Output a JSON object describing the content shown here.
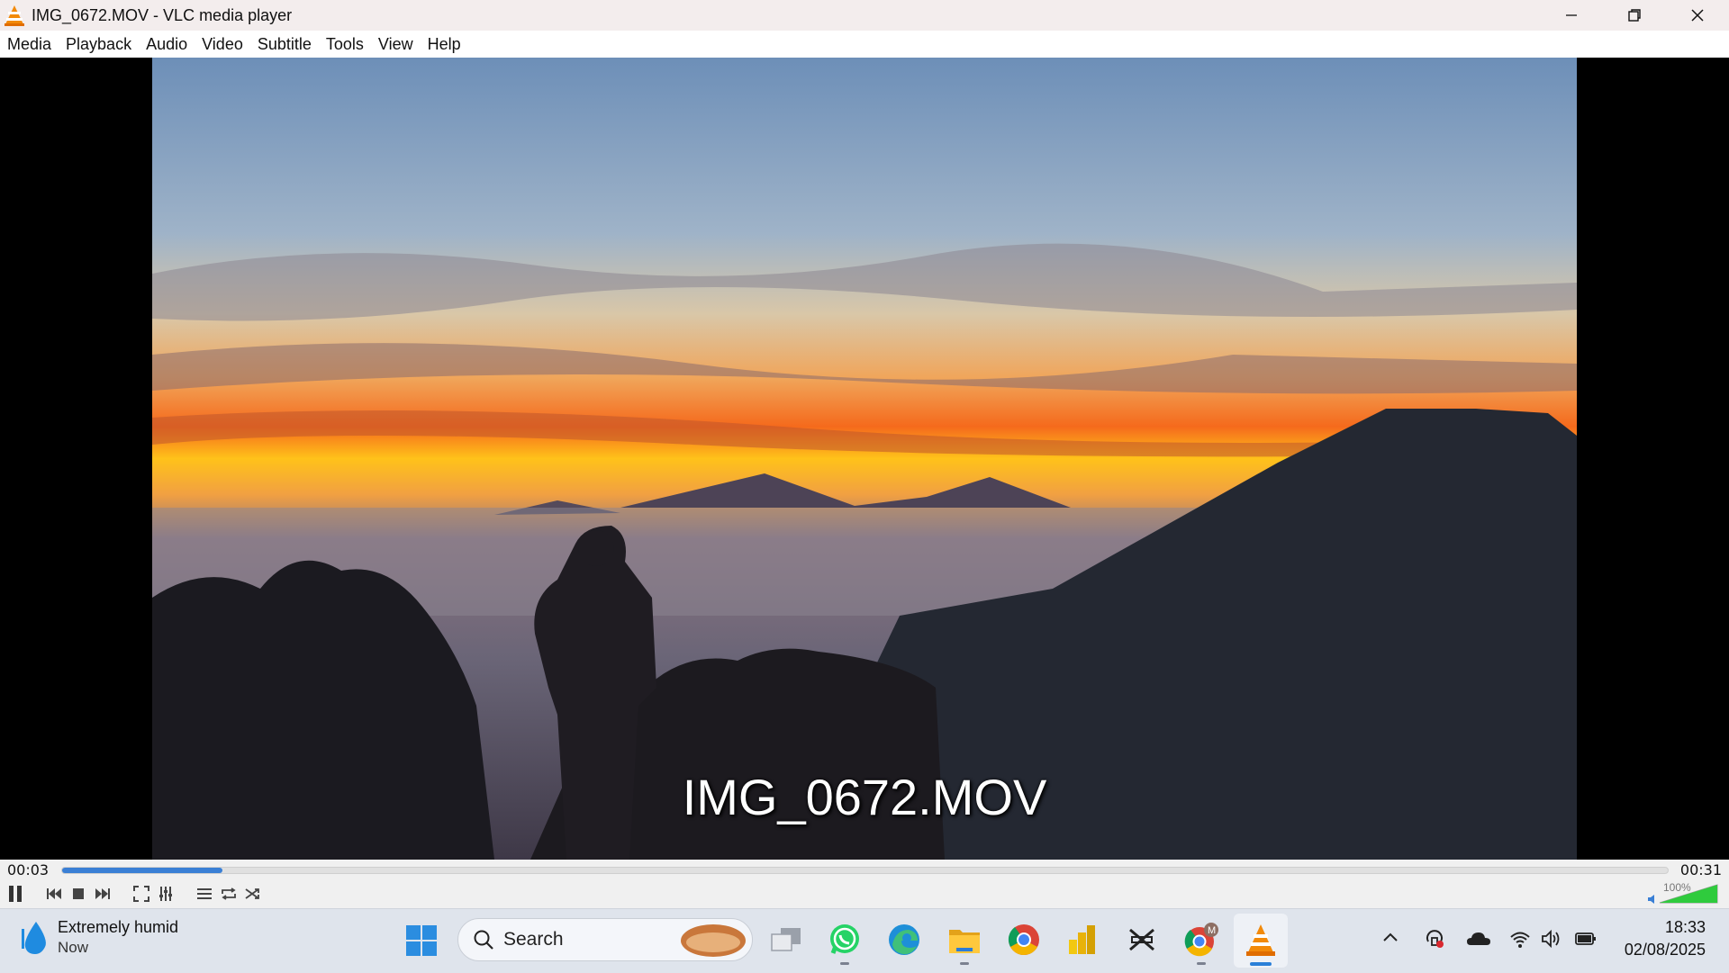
{
  "window": {
    "title": "IMG_0672.MOV - VLC media player",
    "controls": [
      "minimize-icon",
      "restore-icon",
      "close-icon"
    ]
  },
  "menu": [
    "Media",
    "Playback",
    "Audio",
    "Video",
    "Subtitle",
    "Tools",
    "View",
    "Help"
  ],
  "video": {
    "osd_title": "IMG_0672.MOV"
  },
  "playback": {
    "elapsed": "00:03",
    "duration": "00:31",
    "progress_fraction": 0.1,
    "volume_label": "100%",
    "volume_fraction": 1.0,
    "accent_color": "#3a7fd5",
    "buttons": [
      "pause-icon",
      "previous-icon",
      "stop-icon",
      "next-icon",
      "fullscreen-icon",
      "extended-settings-icon",
      "playlist-icon",
      "loop-icon",
      "shuffle-icon"
    ]
  },
  "taskbar": {
    "weather_title": "Extremely humid",
    "weather_sub": "Now",
    "search_placeholder": "Search",
    "apps": [
      "task-view-icon",
      "whatsapp-icon",
      "edge-icon",
      "file-explorer-icon",
      "chrome-icon",
      "power-bi-icon",
      "capcut-icon",
      "chrome-profile-icon",
      "vlc-icon"
    ],
    "chrome_profile_badge": "M",
    "clock_time": "18:33",
    "clock_date": "02/08/2025"
  }
}
